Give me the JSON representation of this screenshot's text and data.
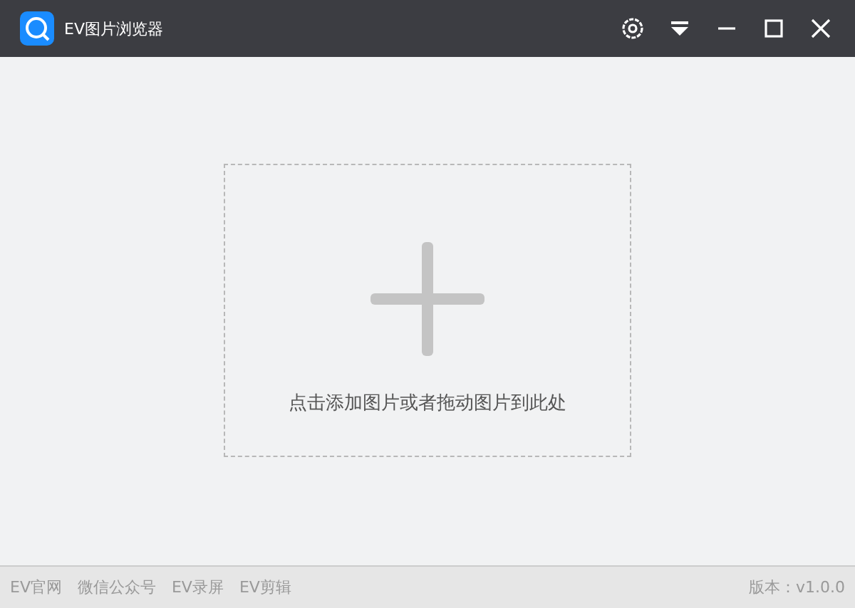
{
  "window": {
    "title": "EV图片浏览器"
  },
  "drop_zone": {
    "hint": "点击添加图片或者拖动图片到此处"
  },
  "footer": {
    "links": [
      "EV官网",
      "微信公众号",
      "EV录屏",
      "EV剪辑"
    ],
    "version": "版本：v1.0.0"
  }
}
